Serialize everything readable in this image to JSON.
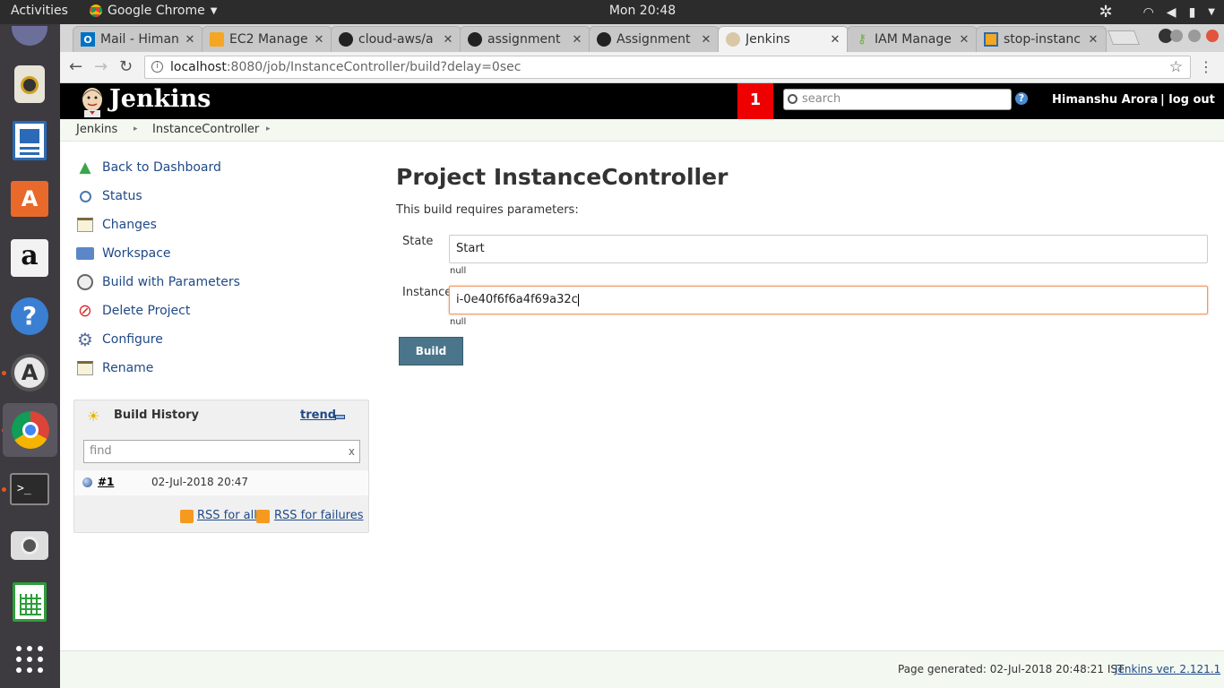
{
  "system_bar": {
    "activities": "Activities",
    "app_name": "Google Chrome",
    "clock": "Mon 20:48"
  },
  "browser": {
    "tabs": [
      {
        "title": "Mail - Himan",
        "icon": "outlook-icon",
        "color": "#0072c6"
      },
      {
        "title": "EC2 Manage",
        "icon": "aws-box-icon",
        "color": "#f5a623"
      },
      {
        "title": "cloud-aws/a",
        "icon": "github-icon",
        "color": "#222222"
      },
      {
        "title": "assignment",
        "icon": "github-icon",
        "color": "#222222"
      },
      {
        "title": "Assignment",
        "icon": "github-icon",
        "color": "#222222"
      },
      {
        "title": "Jenkins",
        "icon": "jenkins-icon",
        "color": "#d33833"
      },
      {
        "title": "IAM Manage",
        "icon": "iam-key-icon",
        "color": "#6cae3e"
      },
      {
        "title": "stop-instanc",
        "icon": "aws-cube-icon",
        "color": "#f5a623"
      }
    ],
    "url_host": "localhost",
    "url_rest": ":8080/job/InstanceController/build?delay=0sec"
  },
  "jenkins": {
    "title": "Jenkins",
    "notification_count": "1",
    "search_placeholder": "search",
    "help": "?",
    "user": "Himanshu Arora",
    "logout": "| log out"
  },
  "breadcrumb": [
    "Jenkins",
    "InstanceController"
  ],
  "sidebar": [
    {
      "label": "Back to Dashboard",
      "icon": "up-arrow-icon"
    },
    {
      "label": "Status",
      "icon": "magnifier-icon"
    },
    {
      "label": "Changes",
      "icon": "notepad-icon"
    },
    {
      "label": "Workspace",
      "icon": "folder-icon"
    },
    {
      "label": "Build with Parameters",
      "icon": "clock-play-icon"
    },
    {
      "label": "Delete Project",
      "icon": "no-entry-icon"
    },
    {
      "label": "Configure",
      "icon": "gear-icon"
    },
    {
      "label": "Rename",
      "icon": "notepad-icon"
    }
  ],
  "build_history": {
    "title": "Build History",
    "trend": "trend",
    "find_placeholder": "find",
    "clear": "x",
    "builds": [
      {
        "number": "#1",
        "date": "02-Jul-2018 20:47"
      }
    ],
    "rss_all": "RSS for all",
    "rss_failures": "RSS for failures"
  },
  "main": {
    "title": "Project InstanceController",
    "description": "This build requires parameters:",
    "params": [
      {
        "label": "State",
        "value": "Start",
        "desc": "null"
      },
      {
        "label": "Instance",
        "value": "i-0e40f6f6a4f69a32c",
        "desc": "null"
      }
    ],
    "build_button": "Build"
  },
  "footer": {
    "generated": "Page generated: 02-Jul-2018 20:48:21 IST",
    "version": "Jenkins ver. 2.121.1"
  },
  "colors": {
    "jenkins_header": "#000000",
    "notification": "#ee0000",
    "link": "#204a87",
    "build_button": "#4b758b"
  }
}
